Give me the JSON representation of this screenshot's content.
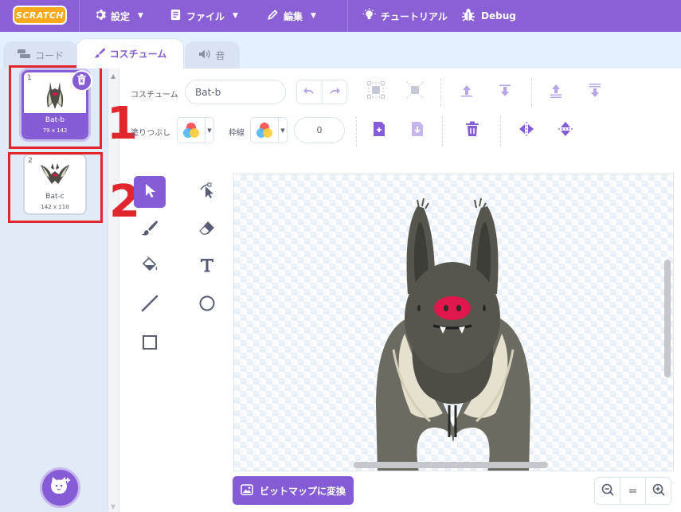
{
  "menubar": {
    "logo": "SCRATCH",
    "settings_label": "設定",
    "file_label": "ファイル",
    "edit_label": "編集",
    "tutorial_label": "チュートリアル",
    "debug_label": "Debug"
  },
  "tabs": {
    "code_label": "コード",
    "costume_label": "コスチューム",
    "sound_label": "音"
  },
  "costumes": [
    {
      "number": "1",
      "name": "Bat-b",
      "size": "79 x 142",
      "selected": true
    },
    {
      "number": "2",
      "name": "Bat-c",
      "size": "142 x 110",
      "selected": false
    }
  ],
  "annotations": {
    "marker1": "1",
    "marker2": "2"
  },
  "editor": {
    "costume_label": "コスチューム",
    "costume_name": "Bat-b",
    "fill_label": "塗りつぶし",
    "outline_label": "枠線",
    "outline_width": "0",
    "convert_bitmap_label": "ビットマップに変換",
    "zoom_reset_label": "="
  },
  "colors": {
    "accent": "#855cd6",
    "menubar": "#8b5fd6",
    "annotation_red": "#e1262d"
  }
}
